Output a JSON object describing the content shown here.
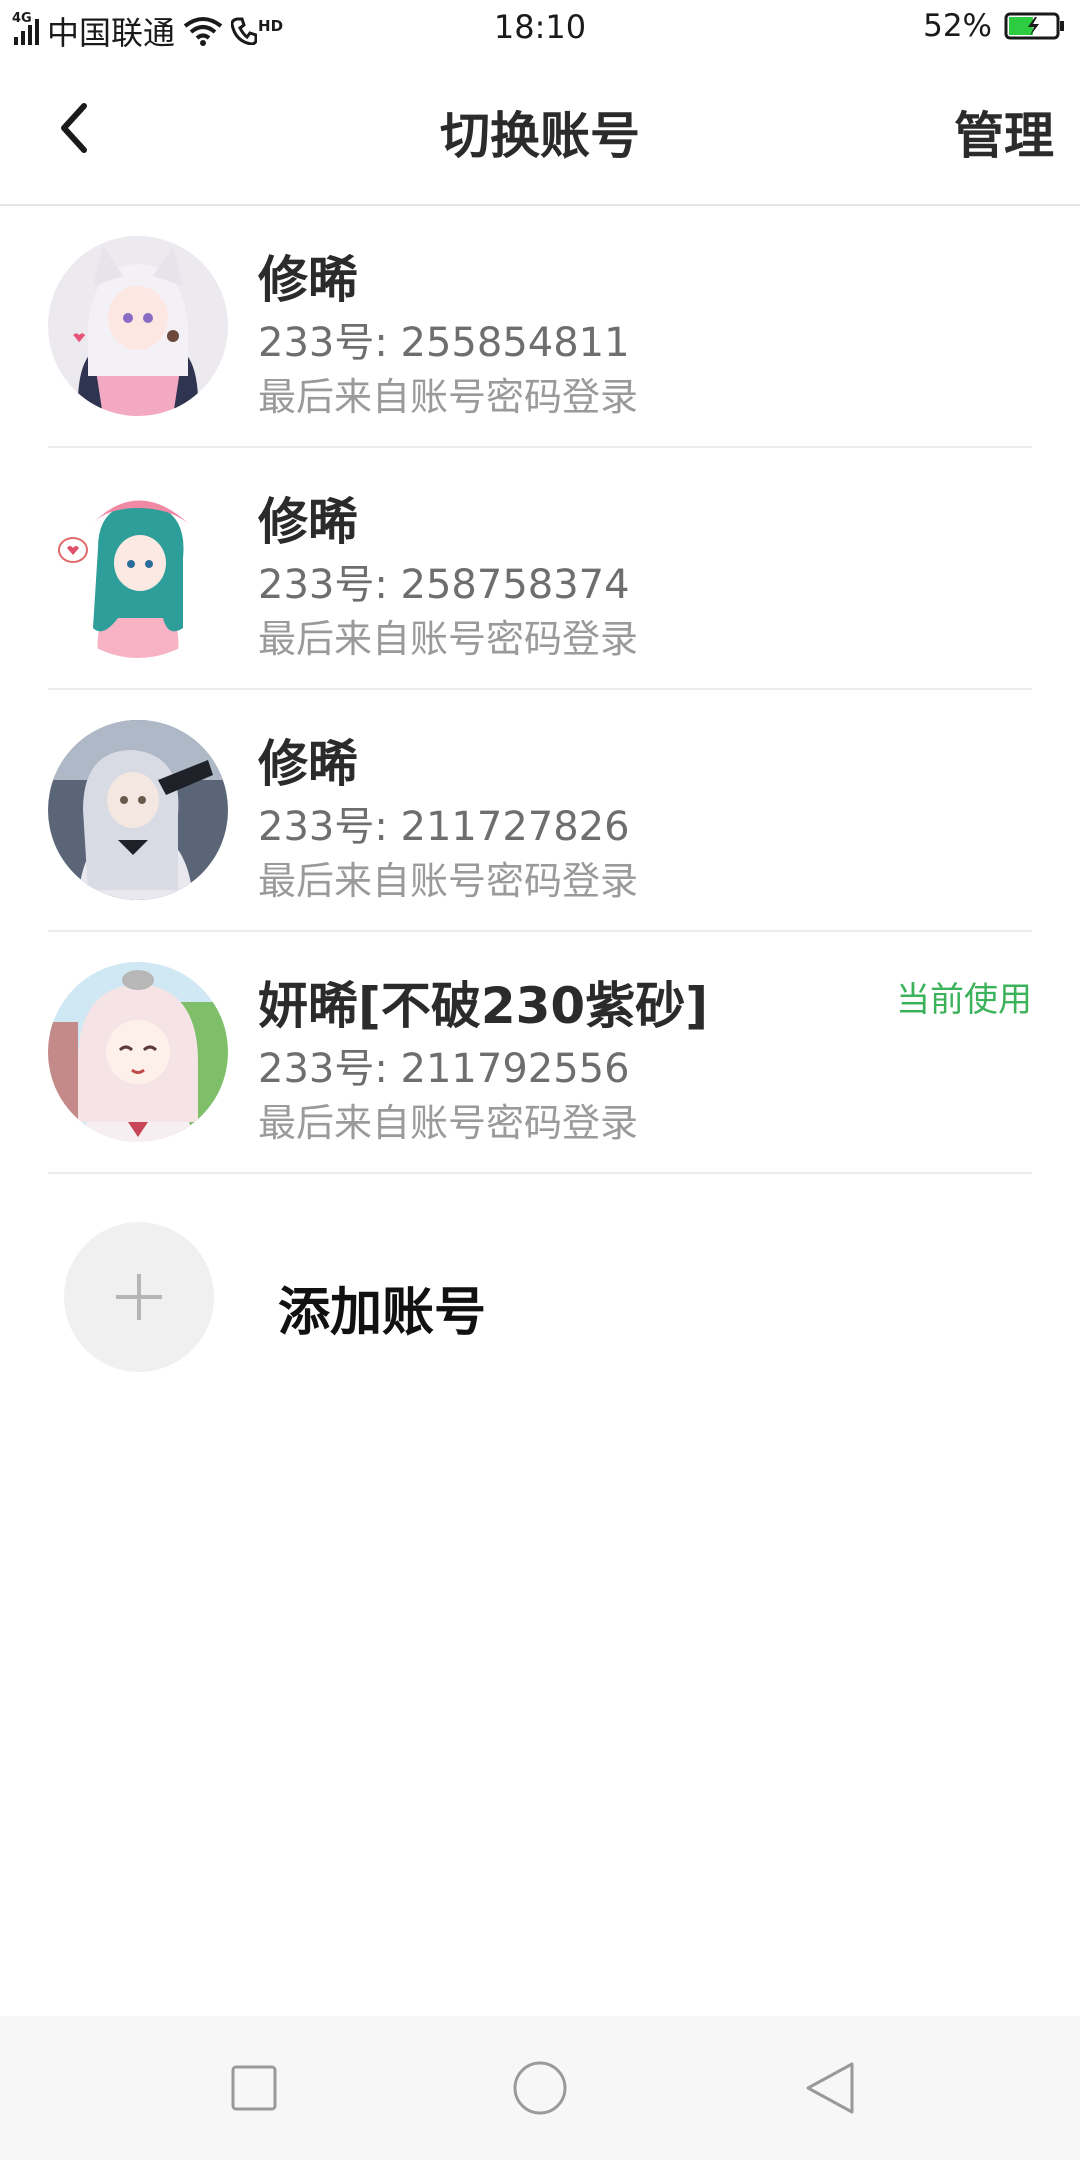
{
  "status_bar": {
    "network_tag": "4G",
    "carrier": "中国联通",
    "hd_tag": "HD",
    "time": "18:10",
    "battery_percent": "52%",
    "battery_level": 0.52,
    "battery_color": "#2ecc40"
  },
  "header": {
    "title": "切换账号",
    "manage_label": "管理",
    "back_icon": "chevron-left-icon"
  },
  "accounts": [
    {
      "name": "修晞",
      "id_text": "233号: 255854811",
      "login_text": "最后来自账号密码登录",
      "current": ""
    },
    {
      "name": "修晞",
      "id_text": "233号: 258758374",
      "login_text": "最后来自账号密码登录",
      "current": ""
    },
    {
      "name": "修晞",
      "id_text": "233号: 211727826",
      "login_text": "最后来自账号密码登录",
      "current": ""
    },
    {
      "name": "妍晞[不破230紫砂]",
      "id_text": "233号: 211792556",
      "login_text": "最后来自账号密码登录",
      "current": "当前使用"
    }
  ],
  "add_account": {
    "label": "添加账号",
    "icon": "plus-icon"
  },
  "colors": {
    "accent_green": "#3cb35b",
    "divider": "#ececec",
    "text_primary": "#2b2b2b",
    "text_secondary": "#6e6e6e",
    "text_tertiary": "#9a9a9a"
  },
  "nav_bar": {
    "buttons": [
      "recents-square-icon",
      "home-circle-icon",
      "back-triangle-icon"
    ]
  }
}
